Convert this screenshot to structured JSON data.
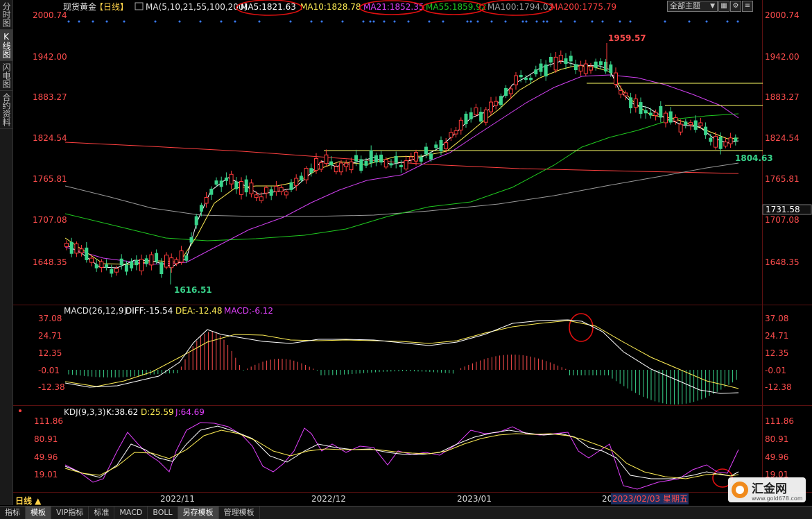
{
  "sidebar": {
    "tabs": [
      {
        "label": "分时图"
      },
      {
        "label": "K线图",
        "active": true
      },
      {
        "label": "闪电图"
      },
      {
        "label": "合约资料"
      }
    ]
  },
  "header": {
    "instrument": "现货黄金",
    "period": "【日线】",
    "ma_params": "MA(5,10,21,55,100,200)",
    "ma5": "MA5:1821.63",
    "ma10": "MA10:1828.78",
    "ma21": "MA21:1852.35",
    "ma55": "MA55:1859.92",
    "ma100": "MA100:1794.02",
    "ma200": "MA200:1775.79",
    "theme": "全部主题"
  },
  "colors": {
    "up": "#ff3b3b",
    "down": "#39d48b",
    "ma5": "#ffffff",
    "ma10": "#ffee55",
    "ma21": "#e040fb",
    "ma55": "#20c820",
    "ma100": "#a0a0a0",
    "ma200": "#ff4040",
    "axis_text": "#ff4d4d",
    "annotation": "#ff2020"
  },
  "main_axis": {
    "ticks": [
      "2000.74",
      "1942.00",
      "1883.27",
      "1824.54",
      "1765.81",
      "1707.08",
      "1648.35"
    ],
    "current_price": "1731.58"
  },
  "annotations": {
    "high": "1959.57",
    "low": "1616.51",
    "recent_low": "1804.63"
  },
  "macd": {
    "label": "MACD(26,12,9)",
    "diff": "DIFF:-15.54",
    "dea": "DEA:-12.48",
    "macd": "MACD:-6.12",
    "ticks": [
      "37.08",
      "24.71",
      "12.35",
      "-0.01",
      "-12.38"
    ]
  },
  "kdj": {
    "label": "KDJ(9,3,3)",
    "k": "K:38.62",
    "d": "D:25.59",
    "j": "J:64.69",
    "ticks": [
      "111.86",
      "80.91",
      "49.96",
      "19.01"
    ]
  },
  "xaxis": {
    "labels": [
      "2022/11",
      "2022/12",
      "2023/01",
      "20"
    ],
    "cursor_date": "2023/02/03 星期五"
  },
  "period_button": "日线 ▲",
  "bottom_tabs": [
    {
      "label": "指标"
    },
    {
      "label": "模板",
      "active": true
    },
    {
      "label": "VIP指标"
    },
    {
      "label": "标准"
    },
    {
      "label": "MACD"
    },
    {
      "label": "BOLL"
    },
    {
      "label": "另存模板",
      "active": true
    },
    {
      "label": "管理模板"
    }
  ],
  "brand": {
    "name": "汇金网",
    "url": "www.gold678.com"
  }
}
